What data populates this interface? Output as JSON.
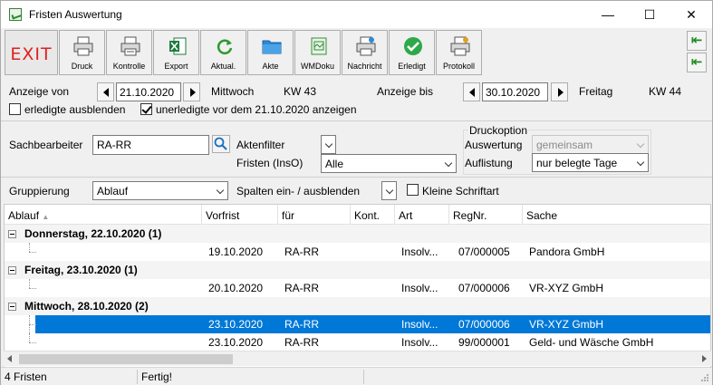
{
  "window": {
    "title": "Fristen Auswertung",
    "minimize": "—",
    "maximize": "☐",
    "close": "✕"
  },
  "toolbar": {
    "exit": "EXIT",
    "buttons": [
      {
        "label": "Druck",
        "icon": "printer-icon"
      },
      {
        "label": "Kontrolle",
        "icon": "printer-check-icon"
      },
      {
        "label": "Export",
        "icon": "excel-icon"
      },
      {
        "label": "Aktual.",
        "icon": "refresh-icon"
      },
      {
        "label": "Akte",
        "icon": "folder-icon"
      },
      {
        "label": "WMDoku",
        "icon": "document-icon"
      },
      {
        "label": "Nachricht",
        "icon": "message-printer-icon"
      },
      {
        "label": "Erledigt",
        "icon": "checkmark-icon"
      },
      {
        "label": "Protokoll",
        "icon": "protocol-printer-icon"
      }
    ],
    "side_button_1": "⇤",
    "side_button_2": "⇤"
  },
  "range": {
    "from_label": "Anzeige von",
    "from_date": "21.10.2020",
    "from_weekday": "Mittwoch",
    "from_week": "KW 43",
    "to_label": "Anzeige bis",
    "to_date": "30.10.2020",
    "to_weekday": "Freitag",
    "to_week": "KW 44"
  },
  "filters": {
    "hide_done_label": "erledigte ausblenden",
    "hide_done_checked": false,
    "show_open_label": "unerledigte vor dem 21.10.2020 anzeigen",
    "show_open_checked": true
  },
  "agent": {
    "label": "Sachbearbeiter",
    "value": "RA-RR",
    "akten_filter_label": "Aktenfilter",
    "fristen_label": "Fristen (InsO)",
    "fristen_value": "Alle"
  },
  "print_option": {
    "group_label": "Druckoption",
    "auswertung_label": "Auswertung",
    "auswertung_value": "gemeinsam",
    "auflistung_label": "Auflistung",
    "auflistung_value": "nur belegte Tage"
  },
  "grouping": {
    "label": "Gruppierung",
    "value": "Ablauf",
    "columns_label": "Spalten ein- / ausblenden",
    "small_font_label": "Kleine Schriftart",
    "small_font_checked": false
  },
  "grid": {
    "columns": [
      "Ablauf",
      "Vorfrist",
      "für",
      "Kont.",
      "Art",
      "RegNr.",
      "Sache"
    ],
    "sort_indicator": "▲",
    "groups": [
      {
        "title": "Donnerstag, 22.10.2020 (1)",
        "rows": [
          {
            "vorfrist": "19.10.2020",
            "fuer": "RA-RR",
            "kont": "",
            "art": "Insolv...",
            "regnr": "07/000005",
            "sache": "Pandora GmbH",
            "selected": false
          }
        ]
      },
      {
        "title": "Freitag, 23.10.2020 (1)",
        "rows": [
          {
            "vorfrist": "20.10.2020",
            "fuer": "RA-RR",
            "kont": "",
            "art": "Insolv...",
            "regnr": "07/000006",
            "sache": "VR-XYZ GmbH",
            "selected": false
          }
        ]
      },
      {
        "title": "Mittwoch, 28.10.2020 (2)",
        "rows": [
          {
            "vorfrist": "23.10.2020",
            "fuer": "RA-RR",
            "kont": "",
            "art": "Insolv...",
            "regnr": "07/000006",
            "sache": "VR-XYZ GmbH",
            "selected": true
          },
          {
            "vorfrist": "23.10.2020",
            "fuer": "RA-RR",
            "kont": "",
            "art": "Insolv...",
            "regnr": "99/000001",
            "sache": "Geld- und Wäsche GmbH",
            "selected": false
          }
        ]
      }
    ]
  },
  "status": {
    "count": "4 Fristen",
    "state": "Fertig!"
  }
}
